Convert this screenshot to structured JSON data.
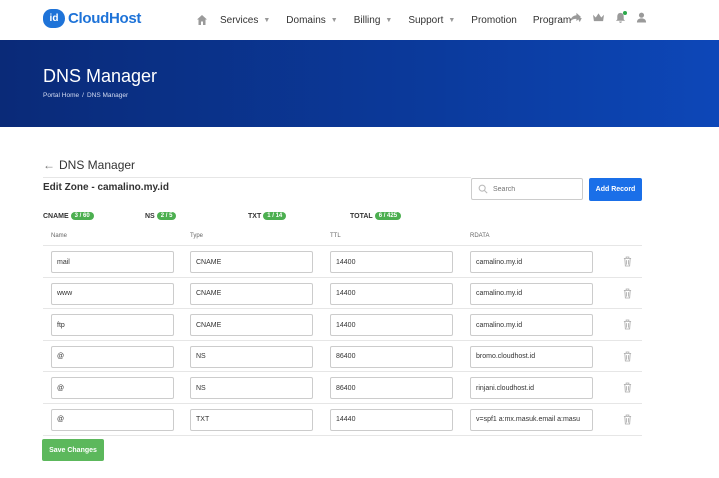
{
  "brand": {
    "badge": "id",
    "name": "CloudHost",
    "color": "#1e73d8"
  },
  "nav": {
    "items": [
      {
        "label": "Services",
        "caret": true
      },
      {
        "label": "Domains",
        "caret": true
      },
      {
        "label": "Billing",
        "caret": true
      },
      {
        "label": "Support",
        "caret": true
      },
      {
        "label": "Promotion",
        "caret": false
      },
      {
        "label": "Program",
        "caret": true
      }
    ],
    "icons": [
      "home-icon",
      "share-icon",
      "crown-icon",
      "bell-icon",
      "user-icon"
    ]
  },
  "hero": {
    "title": "DNS Manager",
    "breadcrumb": [
      "Portal Home",
      "DNS Manager"
    ]
  },
  "page": {
    "back_title": "DNS Manager",
    "zone_title": "Edit Zone - camalino.my.id",
    "search_placeholder": "Search",
    "add_label": "Add Record",
    "save_label": "Save Changes"
  },
  "stats": [
    {
      "label": "CNAME",
      "value": "3 / 60"
    },
    {
      "label": "NS",
      "value": "2 / 5"
    },
    {
      "label": "TXT",
      "value": "1 / 14"
    },
    {
      "label": "TOTAL",
      "value": "6 / 425"
    }
  ],
  "columns": [
    "Name",
    "Type",
    "TTL",
    "RDATA"
  ],
  "records": [
    {
      "name": "mail",
      "type": "CNAME",
      "ttl": "14400",
      "rdata": "camalino.my.id"
    },
    {
      "name": "www",
      "type": "CNAME",
      "ttl": "14400",
      "rdata": "camalino.my.id"
    },
    {
      "name": "ftp",
      "type": "CNAME",
      "ttl": "14400",
      "rdata": "camalino.my.id"
    },
    {
      "name": "@",
      "type": "NS",
      "ttl": "86400",
      "rdata": "bromo.cloudhost.id"
    },
    {
      "name": "@",
      "type": "NS",
      "ttl": "86400",
      "rdata": "rinjani.cloudhost.id"
    },
    {
      "name": "@",
      "type": "TXT",
      "ttl": "14440",
      "rdata": "v=spf1 a:mx.masuk.email a:masu"
    }
  ],
  "colors": {
    "hero_start": "#0a2a78",
    "hero_end": "#0d47b8",
    "primary": "#1a6fe8",
    "success": "#5cb85c",
    "pill": "#4caf50"
  }
}
